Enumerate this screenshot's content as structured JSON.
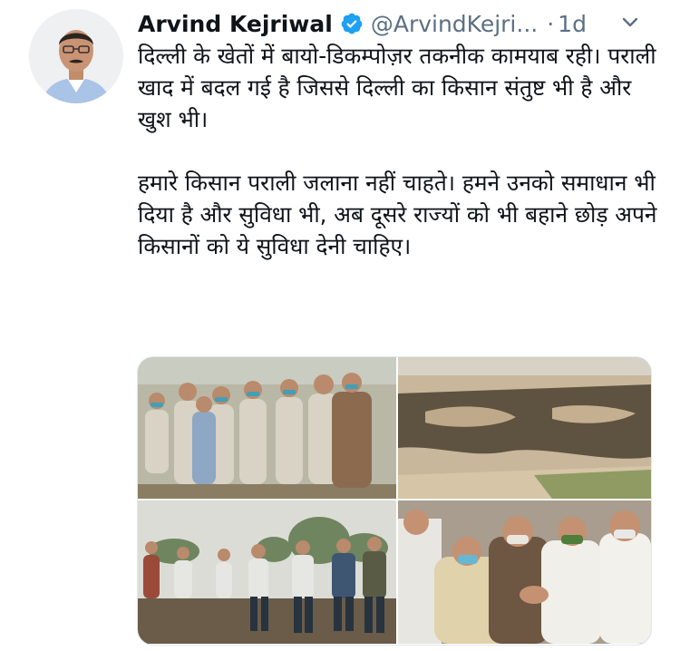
{
  "tweet": {
    "author_name": "Arvind Kejriwal",
    "handle": "@ArvindKejri...",
    "separator": "·",
    "time": "1d",
    "paragraphs": [
      "दिल्ली के खेतों में बायो-डिकम्पोज़र तकनीक कामयाब रही। पराली खाद में बदल गई है जिससे दिल्ली का किसान संतुष्ट भी है और खुश भी।",
      "हमारे किसान पराली जलाना नहीं चाहते। हमने उनको समाधान भी दिया है और सुविधा भी, अब दूसरे राज्यों को भी बहाने छोड़ अपने किसानों को ये सुविधा देनी चाहिए।"
    ],
    "icons": {
      "verified": "verified-badge-icon",
      "more": "chevron-down-icon"
    },
    "colors": {
      "verified": "#1da1f2",
      "secondary_text": "#5b7083",
      "primary_text": "#0f1419"
    },
    "media_count": 4
  }
}
